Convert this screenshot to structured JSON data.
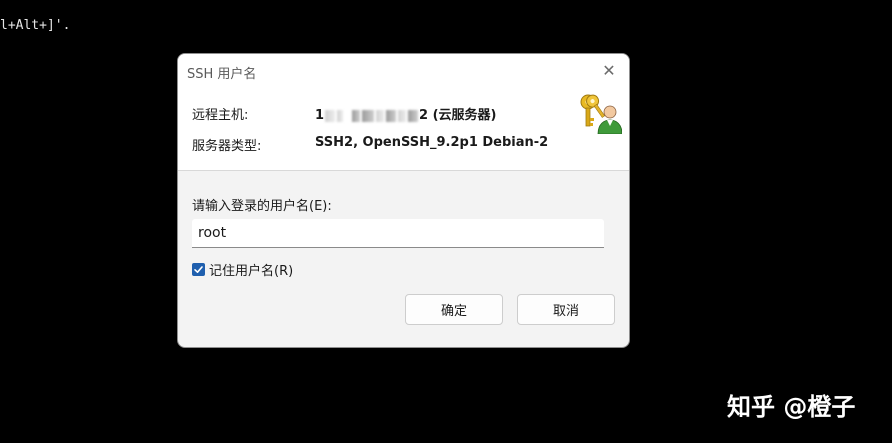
{
  "terminal": {
    "line": "l+Alt+]'."
  },
  "dialog": {
    "title": "SSH 用户名",
    "close_symbol": "✕",
    "remote_host": {
      "label": "远程主机:",
      "value_prefix": "1",
      "value_suffix": "2 (云服务器)"
    },
    "server_type": {
      "label": "服务器类型:",
      "value": "SSH2, OpenSSH_9.2p1 Debian-2"
    },
    "icon": "keys-user-icon",
    "prompt_label": "请输入登录的用户名(E):",
    "username_value": "root",
    "remember": {
      "label": "记住用户名(R)",
      "checked": true
    },
    "ok_label": "确定",
    "cancel_label": "取消"
  },
  "watermark": "知乎 @橙子",
  "colors": {
    "checkbox_accent": "#1f5fae",
    "dialog_background": "#f3f3f3",
    "terminal_background": "#000000"
  }
}
